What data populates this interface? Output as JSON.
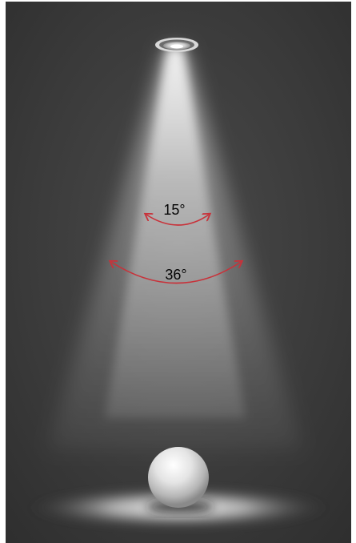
{
  "beam_angles": [
    {
      "label": "15°",
      "color": "#c8323a"
    },
    {
      "label": "36°",
      "color": "#c8323a"
    }
  ],
  "colors": {
    "background": "#3a3a3a",
    "beam": "#f2f2f2",
    "arrow": "#c8323a",
    "label_text": "#050505"
  },
  "icons": {
    "fixture": "recessed-downlight-icon",
    "sphere": "sphere-object"
  }
}
